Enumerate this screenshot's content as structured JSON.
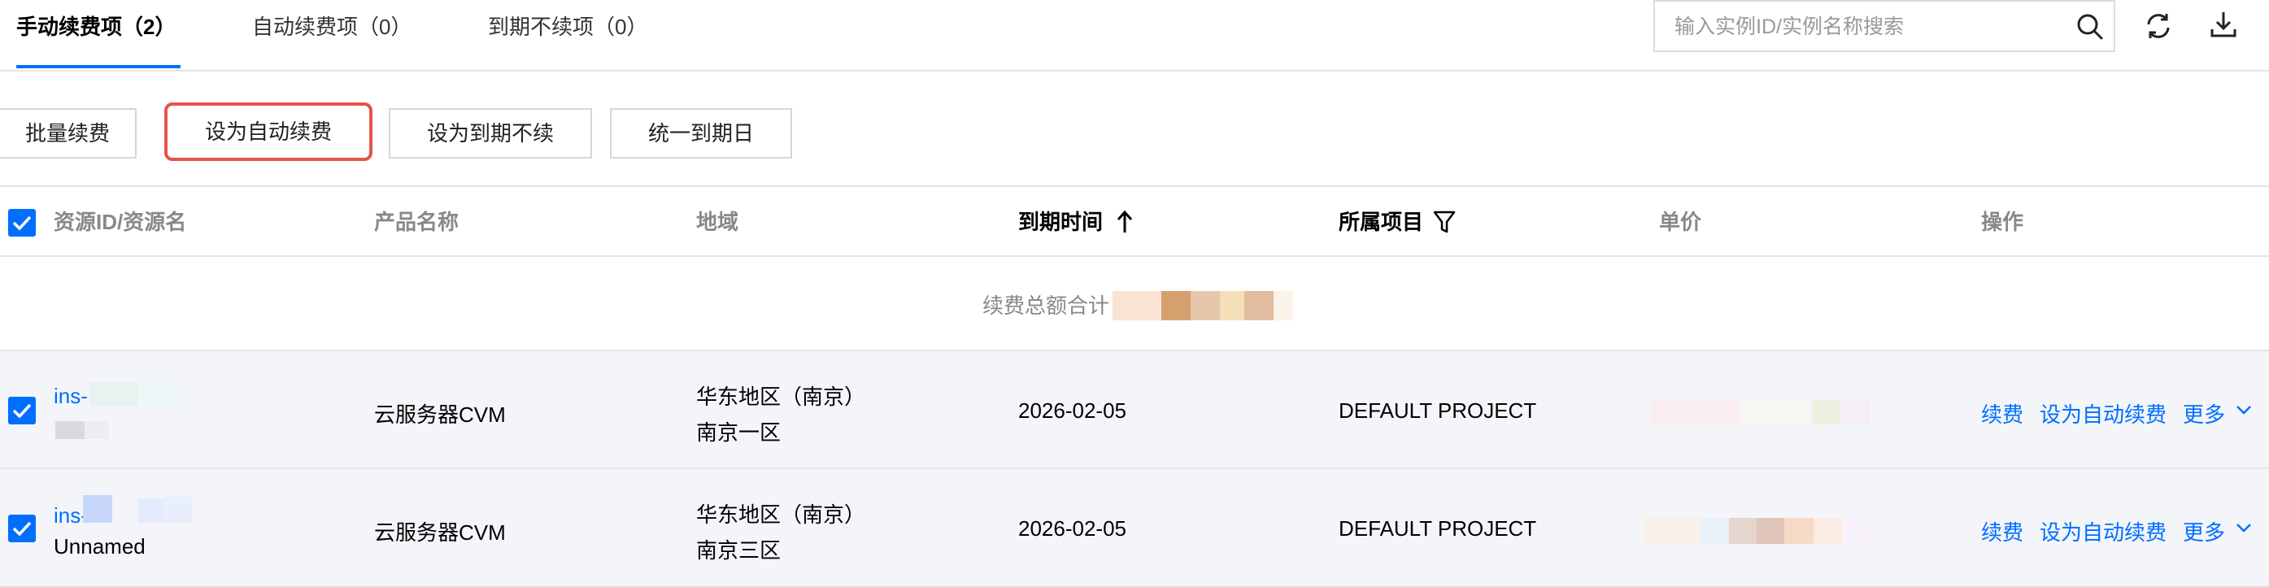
{
  "tabs": [
    {
      "label": "手动续费项（2）",
      "active": true
    },
    {
      "label": "自动续费项（0）",
      "active": false
    },
    {
      "label": "到期不续项（0）",
      "active": false
    }
  ],
  "search": {
    "placeholder": "输入实例ID/实例名称搜索",
    "value": ""
  },
  "header_icons": [
    "search-icon",
    "refresh-icon",
    "download-icon"
  ],
  "toolbar": {
    "batch_renew": "批量续费",
    "set_auto_renew": "设为自动续费",
    "set_no_renew": "设为到期不续",
    "unify_expiry": "统一到期日"
  },
  "table": {
    "columns": {
      "resource": "资源ID/资源名",
      "product": "产品名称",
      "region": "地域",
      "expiry": "到期时间",
      "project": "所属项目",
      "price": "单价",
      "ops": "操作"
    },
    "total_label": "续费总额合计",
    "rows": [
      {
        "id": "ins-",
        "name": "",
        "product": "云服务器CVM",
        "region": "华东地区（南京）",
        "zone": "南京一区",
        "expiry": "2026-02-05",
        "project": "DEFAULT PROJECT"
      },
      {
        "id": "ins-",
        "name": "Unnamed",
        "product": "云服务器CVM",
        "region": "华东地区（南京）",
        "zone": "南京三区",
        "expiry": "2026-02-05",
        "project": "DEFAULT PROJECT"
      }
    ],
    "row_actions": {
      "renew": "续费",
      "auto_renew": "设为自动续费",
      "more": "更多"
    }
  },
  "colors": {
    "accent": "#006eff",
    "highlight_border": "#e0564a",
    "row_bg": "#f3f5f9"
  }
}
